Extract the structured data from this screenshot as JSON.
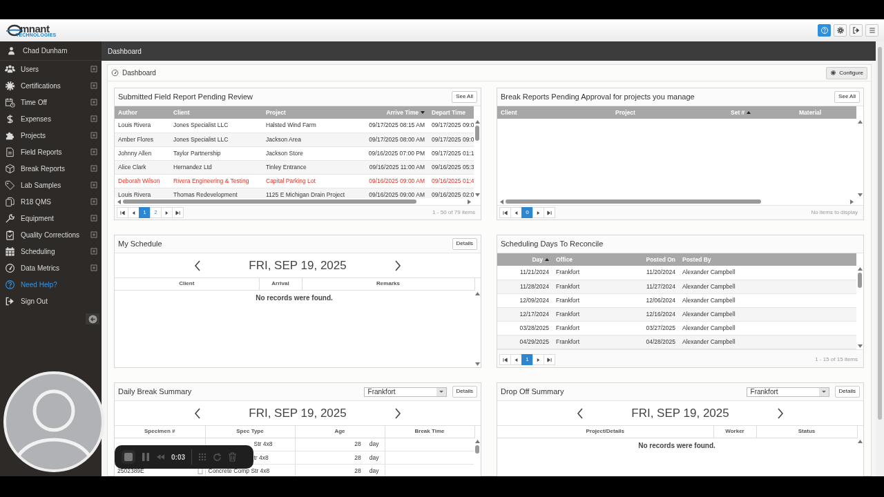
{
  "header": {
    "logo": {
      "wordmark": "mnant",
      "tagline": "TECHNOLOGIES"
    }
  },
  "sidebar": {
    "user": "Chad Dunham",
    "items": [
      {
        "label": "Users",
        "kind": "menu",
        "expandable": true
      },
      {
        "label": "Certifications",
        "kind": "menu",
        "expandable": true
      },
      {
        "label": "Time Off",
        "kind": "menu",
        "expandable": true
      },
      {
        "label": "Expenses",
        "kind": "menu",
        "expandable": true
      },
      {
        "label": "Projects",
        "kind": "menu",
        "expandable": true
      },
      {
        "label": "Field Reports",
        "kind": "menu",
        "expandable": true
      },
      {
        "label": "Break Reports",
        "kind": "menu",
        "expandable": true
      },
      {
        "label": "Lab Samples",
        "kind": "menu",
        "expandable": true
      },
      {
        "label": "R18 QMS",
        "kind": "menu",
        "expandable": true
      },
      {
        "label": "Equipment",
        "kind": "menu",
        "expandable": true
      },
      {
        "label": "Quality Corrections",
        "kind": "menu",
        "expandable": true
      },
      {
        "label": "Scheduling",
        "kind": "menu",
        "expandable": true
      },
      {
        "label": "Data Metrics",
        "kind": "menu",
        "expandable": true
      },
      {
        "label": "Need Help?",
        "kind": "help",
        "expandable": false
      },
      {
        "label": "Sign Out",
        "kind": "menu",
        "expandable": false
      }
    ]
  },
  "breadcrumb": "Dashboard",
  "dashboard": {
    "title": "Dashboard",
    "configure_button": "Configure"
  },
  "panels": [
    {
      "kind": "grid",
      "title": "Submitted Field Report Pending Review",
      "button": "See All",
      "columns": [
        {
          "label": "Author"
        },
        {
          "label": "Client"
        },
        {
          "label": "Project"
        },
        {
          "label": "Arrive Time",
          "sort_ascending": false
        },
        {
          "label": "Depart Time"
        }
      ],
      "rows": [
        {
          "flagged": false,
          "cells": [
            "Louis Rivera",
            "Jones Specialist LLC",
            "Halsted Wind Farm",
            "09/17/2025 08:15 AM",
            "09/17/2025 09:0"
          ]
        },
        {
          "flagged": false,
          "cells": [
            "Amber Flores",
            "Jones Specialist LLC",
            "Jackson Area",
            "09/17/2025 08:00 AM",
            "09/17/2025 09:0"
          ]
        },
        {
          "flagged": false,
          "cells": [
            "Johnny Allen",
            "Taylor Partnership",
            "Jackson Store",
            "09/16/2025 07:00 PM",
            "09/17/2025 01:1"
          ]
        },
        {
          "flagged": false,
          "cells": [
            "Alice Clark",
            "Hernandez Ltd",
            "Tinley Entrance",
            "09/16/2025 11:00 AM",
            "09/16/2025 05:3"
          ]
        },
        {
          "flagged": true,
          "cells": [
            "Deborah Wilson",
            "Rivera Engineering & Testing",
            "Capital Parking Lot",
            "09/16/2025 09:00 AM",
            "09/16/2025 01:4"
          ]
        },
        {
          "flagged": false,
          "cells": [
            "Louis Rivera",
            "Thomas Redevelopment",
            "1125 E Michigan Drain Project",
            "09/16/2025 09:00 AM",
            "09/16/2025 02:0"
          ]
        }
      ],
      "pager": {
        "pages": [
          {
            "label": "1",
            "selected": true
          },
          {
            "label": "2",
            "selected": false
          }
        ],
        "info": "1 - 50 of 79 items"
      }
    },
    {
      "kind": "grid",
      "title": "Break Reports Pending Approval for projects you manage",
      "button": "See All",
      "columns": [
        {
          "label": "Client"
        },
        {
          "label": "Project"
        },
        {
          "label": "Set #",
          "sort_ascending": true
        },
        {
          "label": "Material"
        }
      ],
      "pager": {
        "pages": [
          {
            "label": "0",
            "selected": true
          }
        ],
        "info": "No items to display"
      }
    },
    {
      "kind": "calendar",
      "title": "My Schedule",
      "button": "Details",
      "date": "FRI, SEP 19, 2025",
      "columns": [
        {
          "label": "Client"
        },
        {
          "label": "Arrival"
        },
        {
          "label": "Remarks"
        }
      ],
      "empty_message": "No records were found."
    },
    {
      "kind": "grid",
      "title": "Scheduling Days To Reconcile",
      "columns": [
        {
          "label": "Day",
          "sort_ascending": true
        },
        {
          "label": "Office"
        },
        {
          "label": "Posted On"
        },
        {
          "label": "Posted By"
        }
      ],
      "rows": [
        {
          "flagged": false,
          "cells": [
            "11/21/2024",
            "Frankfort",
            "11/20/2024",
            "Alexander Campbell"
          ]
        },
        {
          "flagged": false,
          "cells": [
            "11/28/2024",
            "Frankfort",
            "11/27/2024",
            "Alexander Campbell"
          ]
        },
        {
          "flagged": false,
          "cells": [
            "12/09/2024",
            "Frankfort",
            "12/06/2024",
            "Alexander Campbell"
          ]
        },
        {
          "flagged": false,
          "cells": [
            "12/17/2024",
            "Frankfort",
            "12/16/2024",
            "Alexander Campbell"
          ]
        },
        {
          "flagged": false,
          "cells": [
            "03/28/2025",
            "Frankfort",
            "03/27/2025",
            "Alexander Campbell"
          ]
        },
        {
          "flagged": false,
          "cells": [
            "04/29/2025",
            "Frankfort",
            "04/28/2025",
            "Alexander Campbell"
          ]
        }
      ],
      "pager": {
        "pages": [
          {
            "label": "1",
            "selected": true
          }
        ],
        "info": "1 - 15 of 15 items"
      }
    },
    {
      "kind": "calendar",
      "title": "Daily Break Summary",
      "select": "Frankfort",
      "button": "Details",
      "date": "FRI, SEP 19, 2025",
      "columns": [
        {
          "label": "Specimen #"
        },
        {
          "label": "Spec Type"
        },
        {
          "label": "Age"
        },
        {
          "label": "Break Time"
        }
      ],
      "rows": [
        {
          "spec_type": "Str 4x8",
          "age": "28",
          "unit": "day"
        },
        {
          "spec_type": "tr 4x8",
          "age": "28",
          "unit": "day"
        },
        {
          "specimen": "2502389E",
          "spec_type": "Concrete Comp Str 4x8",
          "age": "28",
          "unit": "day"
        }
      ]
    },
    {
      "kind": "calendar",
      "title": "Drop Off Summary",
      "select": "Frankfort",
      "button": "Details",
      "date": "FRI, SEP 19, 2025",
      "columns": [
        {
          "label": "Project/Details"
        },
        {
          "label": "Worker"
        },
        {
          "label": "Status"
        }
      ],
      "empty_message": "No records were found."
    }
  ],
  "recorder": {
    "time": "0:03"
  }
}
